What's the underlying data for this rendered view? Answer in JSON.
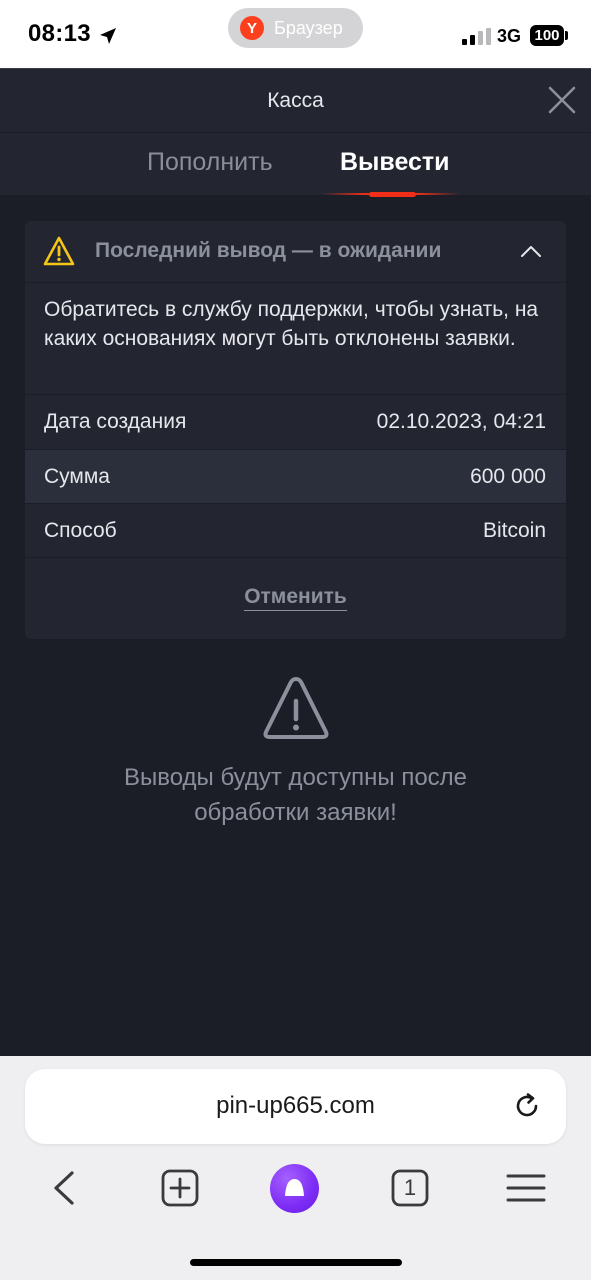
{
  "status_bar": {
    "time": "08:13",
    "browser_pill": {
      "logo": "Y",
      "label": "Браузер"
    },
    "network": "3G",
    "battery": "100"
  },
  "modal": {
    "title": "Касса",
    "tabs": [
      {
        "label": "Пополнить",
        "active": false
      },
      {
        "label": "Вывести",
        "active": true
      }
    ]
  },
  "withdrawal": {
    "header": "Последний вывод — в ожидании",
    "description": "Обратитесь в службу поддержки, чтобы узнать, на каких основаниях могут быть отклонены заявки.",
    "rows": [
      {
        "label": "Дата создания",
        "value": "02.10.2023, 04:21"
      },
      {
        "label": "Сумма",
        "value": "600 000"
      },
      {
        "label": "Способ",
        "value": "Bitcoin"
      }
    ],
    "cancel_label": "Отменить"
  },
  "notice": {
    "line1": "Выводы будут доступны после",
    "line2": "обработки заявки!"
  },
  "browser": {
    "url": "pin-up665.com",
    "tabs_count": "1"
  },
  "colors": {
    "background": "#1b1e27",
    "panel": "#232631",
    "accent_red": "#f12f18",
    "warning_yellow": "#f5c518",
    "alice_purple": "#7d2cf5"
  },
  "icons": [
    "location-arrow-icon",
    "yandex-logo-icon",
    "signal-icon",
    "battery-icon",
    "close-icon",
    "warning-icon",
    "chevron-up-icon",
    "refresh-icon",
    "back-icon",
    "new-tab-icon",
    "alice-icon",
    "tabs-icon",
    "menu-icon"
  ]
}
